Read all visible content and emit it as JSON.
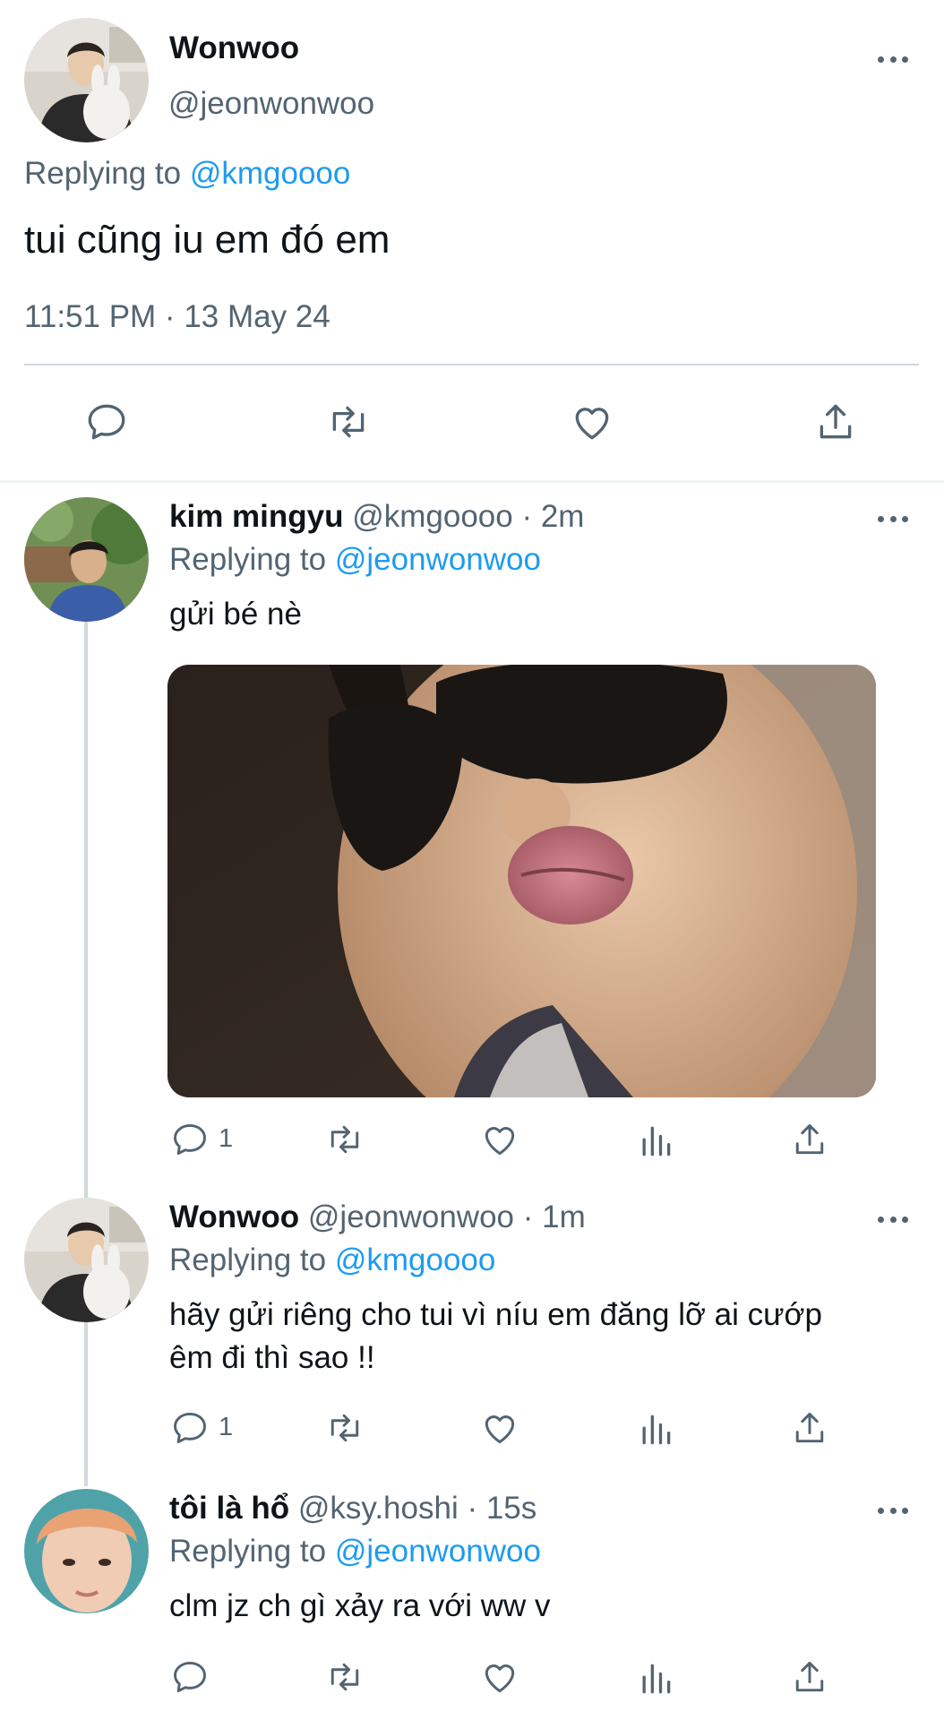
{
  "main_tweet": {
    "name": "Wonwoo",
    "handle": "@jeonwonwoo",
    "replying_prefix": "Replying to",
    "replying_handle": "@kmgoooo",
    "text": "tui cũng iu em đó em",
    "timestamp": "11:51 PM · 13 May 24"
  },
  "replies": [
    {
      "name": "kim mingyu",
      "meta": "@kmgoooo · 2m",
      "replying_prefix": "Replying to",
      "replying_handle": "@jeonwonwoo",
      "text": "gửi bé nè",
      "reply_count": "1"
    },
    {
      "name": "Wonwoo",
      "meta": "@jeonwonwoo · 1m",
      "replying_prefix": "Replying to",
      "replying_handle": "@kmgoooo",
      "text_line1": "hãy gửi riêng cho tui vì níu em đăng lỡ ai cướp",
      "text_line2": "êm đi thì sao !!",
      "reply_count": "1"
    },
    {
      "name": "tôi là hổ",
      "meta": "@ksy.hoshi · 15s",
      "replying_prefix": "Replying to",
      "replying_handle": "@jeonwonwoo",
      "text": "clm jz ch gì xảy ra với ww v"
    }
  ],
  "icons": [
    "reply-icon",
    "retweet-icon",
    "like-icon",
    "share-icon",
    "views-icon",
    "more-icon"
  ],
  "colors": {
    "link": "#1d9bf0",
    "secondary": "#536471",
    "divider": "#cfd9de"
  }
}
